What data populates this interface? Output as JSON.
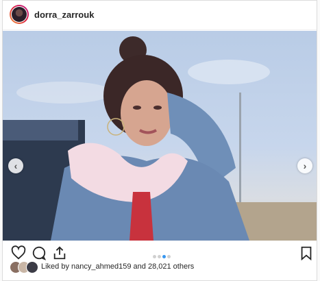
{
  "post": {
    "username": "dorra_zarrouk",
    "liked_by_prefix": "Liked by ",
    "liked_by_user": "nancy_ahmed159",
    "and": " and ",
    "others_count": "28,021 others",
    "carousel_total": 4,
    "carousel_active": 3
  },
  "colors": {
    "accent": "#3897f0",
    "text": "#262626",
    "border": "#dbdbdb"
  },
  "icons": {
    "like": "heart-icon",
    "comment": "comment-icon",
    "share": "share-icon",
    "save": "bookmark-icon",
    "prev": "chevron-left-icon",
    "next": "chevron-right-icon"
  }
}
